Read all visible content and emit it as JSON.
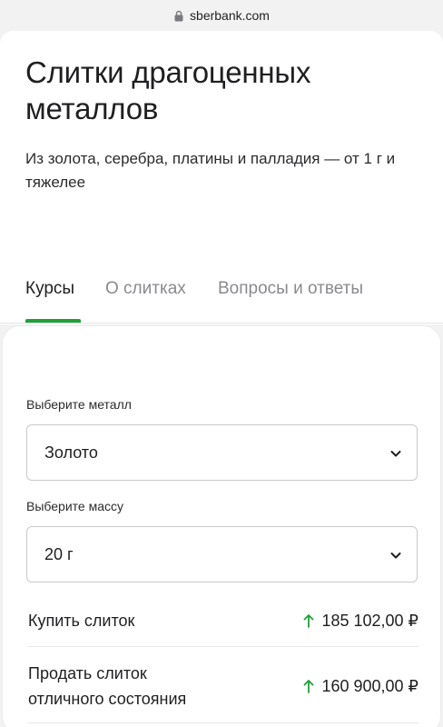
{
  "browser": {
    "url": "sberbank.com"
  },
  "hero": {
    "title": "Слитки драгоценных металлов",
    "subtitle": "Из золота, серебра, платины и палладия — от 1 г и тяжелее"
  },
  "tabs": [
    {
      "label": "Курсы",
      "active": true
    },
    {
      "label": "О слитках",
      "active": false
    },
    {
      "label": "Вопросы и ответы",
      "active": false
    }
  ],
  "form": {
    "metal_label": "Выберите металл",
    "metal_value": "Золото",
    "mass_label": "Выберите массу",
    "mass_value": "20 г"
  },
  "rates": {
    "buy_label": "Купить слиток",
    "buy_value": "185 102,00 ₽",
    "sell_label": "Продать слиток отличного состояния",
    "sell_value": "160 900,00 ₽"
  },
  "colors": {
    "accent": "#21a038"
  },
  "icons": {
    "lock": "lock-icon",
    "chevron": "chevron-down-icon",
    "trend": "arrow-up-icon"
  }
}
